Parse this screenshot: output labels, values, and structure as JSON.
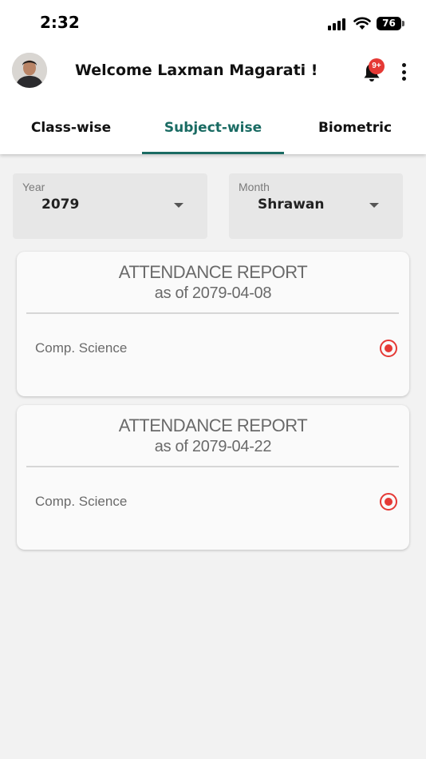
{
  "status_bar": {
    "time": "2:32",
    "battery": "76"
  },
  "header": {
    "welcome": "Welcome Laxman Magarati !",
    "notification_badge": "9+",
    "icons": {
      "notifications": "bell-icon",
      "menu": "more-vert-icon"
    }
  },
  "tabs": [
    {
      "label": "Class-wise",
      "active": false
    },
    {
      "label": "Subject-wise",
      "active": true
    },
    {
      "label": "Biometric",
      "active": false
    }
  ],
  "filters": {
    "year": {
      "label": "Year",
      "value": "2079"
    },
    "month": {
      "label": "Month",
      "value": "Shrawan"
    }
  },
  "reports": [
    {
      "title": "ATTENDANCE REPORT",
      "subtitle": "as of 2079-04-08",
      "subject": "Comp. Science"
    },
    {
      "title": "ATTENDANCE REPORT",
      "subtitle": "as of 2079-04-22",
      "subject": "Comp. Science"
    }
  ],
  "colors": {
    "accent": "#1a6b63",
    "badge": "#e53935",
    "radio": "#e53935",
    "background": "#f2f2f2"
  }
}
